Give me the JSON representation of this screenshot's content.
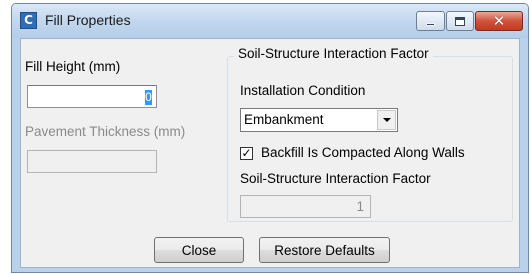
{
  "window": {
    "title": "Fill Properties",
    "icon": "app-icon",
    "icon_glyph": "C"
  },
  "titlebar_buttons": {
    "minimize_icon": "minimize-icon",
    "maximize_icon": "maximize-icon",
    "close_icon": "close-icon",
    "close_glyph": "✕",
    "close_color": "#c13a22"
  },
  "fill_height": {
    "label": "Fill Height (mm)",
    "value": "0"
  },
  "pavement_thickness": {
    "label": "Pavement Thickness (mm)",
    "value": ""
  },
  "ssi_group": {
    "title": "Soil-Structure Interaction Factor",
    "installation_label": "Installation Condition",
    "installation_value": "Embankment",
    "backfill_checked": true,
    "check_glyph": "✓",
    "backfill_label": "Backfill Is Compacted Along Walls",
    "factor_label": "Soil-Structure Interaction Factor",
    "factor_value": "1"
  },
  "buttons": {
    "close_label": "Close",
    "restore_label": "Restore Defaults"
  }
}
